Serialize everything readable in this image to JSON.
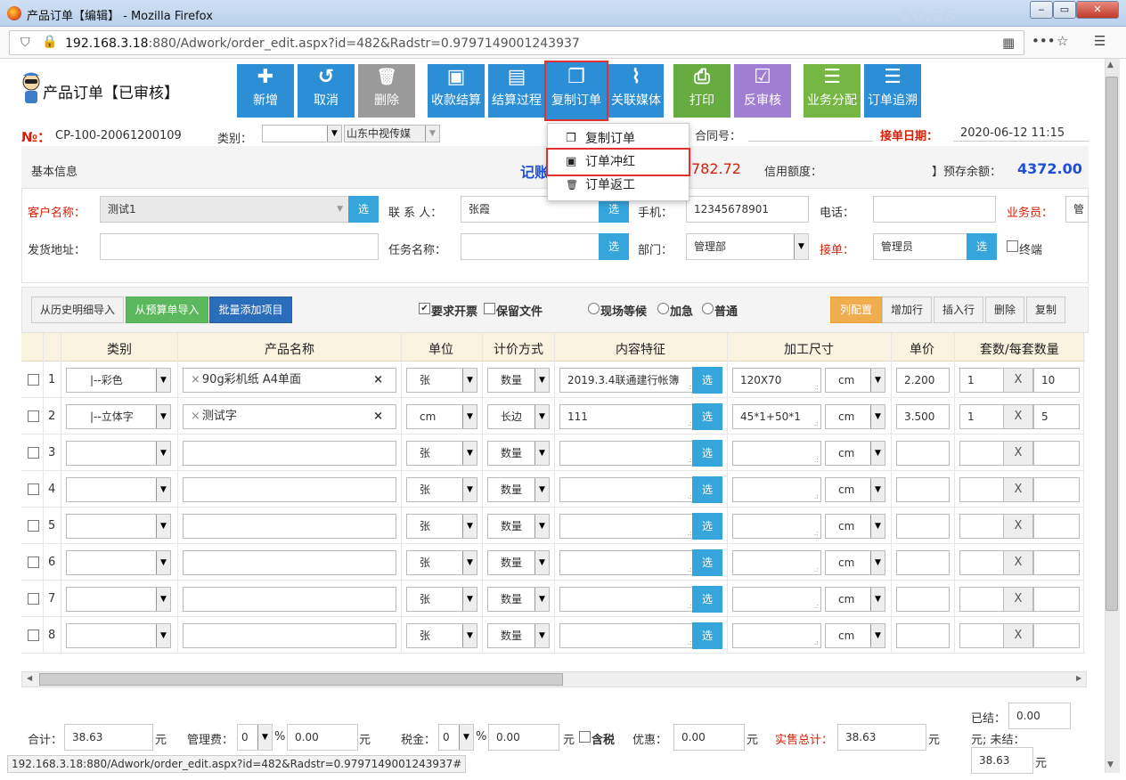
{
  "window": {
    "title": "产品订单【编辑】 - Mozilla Firefox",
    "url_host": "192.168.3.18",
    "url_rest": ":880/Adwork/order_edit.aspx?id=482&Radstr=0.9797149001243937",
    "clock": "16:19"
  },
  "page": {
    "title": "产品订单【已审核】",
    "no_label": "№：",
    "no_value": "CP-100-20061200109",
    "category_label": "类别：",
    "media_value": "山东中视传媒",
    "contract_label": "合同号：",
    "order_date_label": "接单日期：",
    "order_date_value": "2020-06-12 11:15"
  },
  "toolbar": [
    {
      "icon": "plus-icon",
      "glyph": "✚",
      "label": "新增"
    },
    {
      "icon": "undo-icon",
      "glyph": "↺",
      "label": "取消"
    },
    {
      "icon": "trash-icon",
      "glyph": "🗑",
      "label": "删除"
    },
    {
      "icon": "money-icon",
      "glyph": "▣",
      "label": "收款结算"
    },
    {
      "icon": "document-icon",
      "glyph": "▤",
      "label": "结算过程"
    },
    {
      "icon": "copy-icon",
      "glyph": "❐",
      "label": "复制订单"
    },
    {
      "icon": "paperclip-icon",
      "glyph": "⌇",
      "label": "关联媒体"
    },
    {
      "icon": "print-icon",
      "glyph": "⎙",
      "label": "打印"
    },
    {
      "icon": "check-icon",
      "glyph": "☑",
      "label": "反审核"
    },
    {
      "icon": "list-icon",
      "glyph": "☰",
      "label": "业务分配"
    },
    {
      "icon": "list-icon",
      "glyph": "☰",
      "label": "订单追溯"
    }
  ],
  "dropdown": {
    "items": [
      {
        "icon": "copy-icon",
        "glyph": "❐",
        "label": "复制订单"
      },
      {
        "icon": "money-icon",
        "glyph": "▣",
        "label": "订单冲红"
      },
      {
        "icon": "trash-icon",
        "glyph": "🗑",
        "label": "订单返工"
      }
    ]
  },
  "base": {
    "title": "基本信息",
    "mid_text_left": "记账",
    "mid_value": "782.72",
    "credit_label": "信用额度：",
    "prepaid_label": "】预存余额：",
    "prepaid_value": "4372.00",
    "customer_label": "客户名称：",
    "customer_value": "测试1",
    "contact_label": "联 系 人：",
    "contact_value": "张霞",
    "mobile_label": "手机：",
    "mobile_value": "12345678901",
    "phone_label": "电话：",
    "salesman_label": "业务员：",
    "salesman_value": "管",
    "address_label": "发货地址：",
    "task_label": "任务名称：",
    "dept_label": "部门：",
    "dept_value": "管理部",
    "receiver_label": "接单：",
    "receiver_value": "管理员",
    "terminal_label": "终端",
    "select_label": "选"
  },
  "detail": {
    "btn_history": "从历史明细导入",
    "btn_budget": "从预算单导入",
    "btn_batch": "批量添加项目",
    "opt_invoice": "要求开票",
    "opt_keep": "保留文件",
    "opt_onsite": "现场等候",
    "opt_urgent": "加急",
    "opt_normal": "普通",
    "btn_colcfg": "列配置",
    "btn_addrow": "增加行",
    "btn_insert": "插入行",
    "btn_delete": "删除",
    "btn_copy": "复制",
    "columns": [
      "类别",
      "产品名称",
      "单位",
      "计价方式",
      "内容特征",
      "加工尺寸",
      "单价",
      "套数/每套数量"
    ],
    "rows": [
      {
        "no": "1",
        "category": "|--彩色",
        "product": "90g彩机纸 A4单面",
        "unit": "张",
        "pricing": "数量",
        "content": "2019.3.4联通建行帐簿",
        "size": "120X70",
        "size_unit": "cm",
        "price": "2.200",
        "sets": "1",
        "x": "X",
        "qty": "10"
      },
      {
        "no": "2",
        "category": "|--立体字",
        "product": "测试字",
        "unit": "cm",
        "pricing": "长边",
        "content": "111",
        "size": "45*1+50*1",
        "size_unit": "cm",
        "price": "3.500",
        "sets": "1",
        "x": "X",
        "qty": "5"
      },
      {
        "no": "3",
        "category": "",
        "product": "",
        "unit": "张",
        "pricing": "数量",
        "content": "",
        "size": "",
        "size_unit": "cm",
        "price": "",
        "sets": "",
        "x": "X",
        "qty": ""
      },
      {
        "no": "4",
        "category": "",
        "product": "",
        "unit": "张",
        "pricing": "数量",
        "content": "",
        "size": "",
        "size_unit": "cm",
        "price": "",
        "sets": "",
        "x": "X",
        "qty": ""
      },
      {
        "no": "5",
        "category": "",
        "product": "",
        "unit": "张",
        "pricing": "数量",
        "content": "",
        "size": "",
        "size_unit": "cm",
        "price": "",
        "sets": "",
        "x": "X",
        "qty": ""
      },
      {
        "no": "6",
        "category": "",
        "product": "",
        "unit": "张",
        "pricing": "数量",
        "content": "",
        "size": "",
        "size_unit": "cm",
        "price": "",
        "sets": "",
        "x": "X",
        "qty": ""
      },
      {
        "no": "7",
        "category": "",
        "product": "",
        "unit": "张",
        "pricing": "数量",
        "content": "",
        "size": "",
        "size_unit": "cm",
        "price": "",
        "sets": "",
        "x": "X",
        "qty": ""
      },
      {
        "no": "8",
        "category": "",
        "product": "",
        "unit": "张",
        "pricing": "数量",
        "content": "",
        "size": "",
        "size_unit": "cm",
        "price": "",
        "sets": "",
        "x": "X",
        "qty": ""
      }
    ],
    "select_label": "选",
    "remove_mark": "×"
  },
  "footer": {
    "total_label": "合计：",
    "total_value": "38.63",
    "yuan": "元",
    "mgmt_label": "管理费：",
    "mgmt_pct": "0",
    "mgmt_value": "0.00",
    "tax_label": "税金：",
    "tax_pct": "0",
    "tax_value": "0.00",
    "tax_incl": "含税",
    "discount_label": "优惠：",
    "discount_value": "0.00",
    "sale_total_label": "实售总计：",
    "sale_total_value": "38.63",
    "settled_label": "已结：",
    "settled_value": "0.00",
    "unsettled_label": "元; 未结：",
    "unsettled_value": "38.63",
    "percent": "%"
  },
  "status_bar": "192.168.3.18:880/Adwork/order_edit.aspx?id=482&Radstr=0.9797149001243937#"
}
